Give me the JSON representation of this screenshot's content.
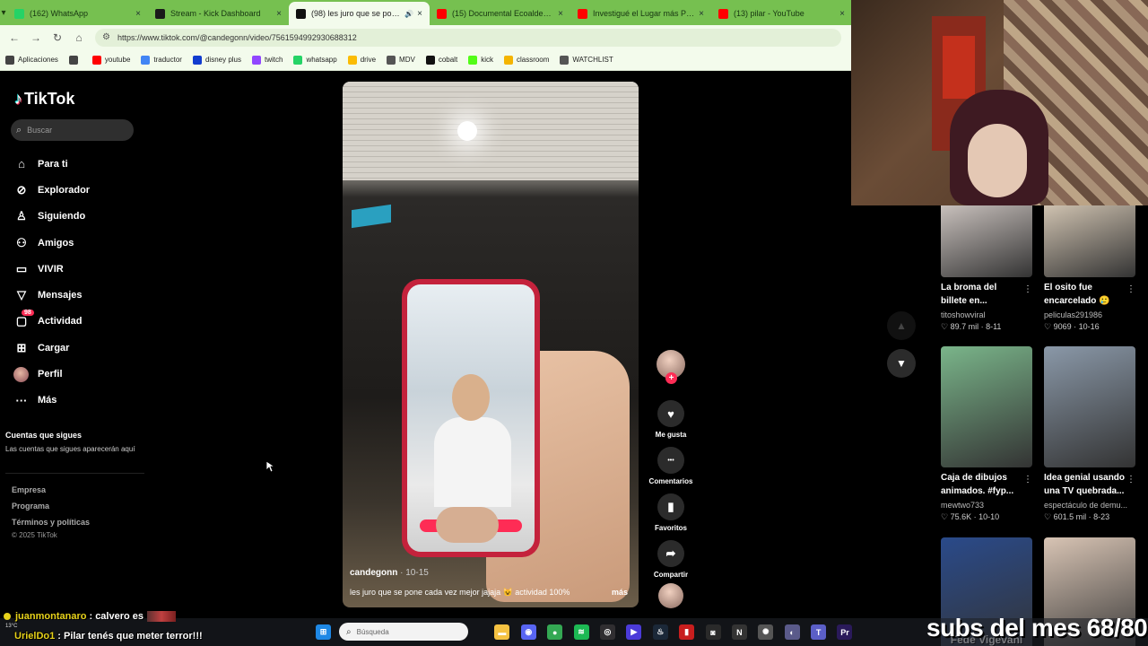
{
  "browser": {
    "tabs": [
      {
        "title": "(162) WhatsApp",
        "icon": "whatsapp-icon",
        "color": "#25d366"
      },
      {
        "title": "Stream - Kick Dashboard",
        "icon": "kick-icon",
        "color": "#1a1a1a"
      },
      {
        "title": "(98) les juro que se pone c...",
        "icon": "tiktok-icon",
        "color": "#111111",
        "active": true
      },
      {
        "title": "(15) Documental Ecoaldea Velo...",
        "icon": "youtube-icon",
        "color": "#ff0000"
      },
      {
        "title": "Investigué el Lugar más Paran...",
        "icon": "youtube-icon",
        "color": "#ff0000"
      },
      {
        "title": "(13) pilar - YouTube",
        "icon": "youtube-icon",
        "color": "#ff0000"
      }
    ],
    "url": "https://www.tiktok.com/@candegonn/video/7561594992930688312",
    "bookmarks": [
      {
        "label": "Aplicaciones",
        "icon": "apps-grid-icon",
        "color": "#444444"
      },
      {
        "label": "",
        "icon": "grid-icon",
        "color": "#444444"
      },
      {
        "label": "youtube",
        "icon": "youtube-icon",
        "color": "#ff0000"
      },
      {
        "label": "traductor",
        "icon": "translate-icon",
        "color": "#4285f4"
      },
      {
        "label": "disney plus",
        "icon": "disney-icon",
        "color": "#113ccf"
      },
      {
        "label": "twitch",
        "icon": "twitch-icon",
        "color": "#9146ff"
      },
      {
        "label": "whatsapp",
        "icon": "whatsapp-icon",
        "color": "#25d366"
      },
      {
        "label": "drive",
        "icon": "drive-icon",
        "color": "#fbbc04"
      },
      {
        "label": "MDV",
        "icon": "folder-icon",
        "color": "#555555"
      },
      {
        "label": "cobalt",
        "icon": "cobalt-icon",
        "color": "#111111"
      },
      {
        "label": "kick",
        "icon": "kick-icon",
        "color": "#53fc18"
      },
      {
        "label": "classroom",
        "icon": "classroom-icon",
        "color": "#f4b400"
      },
      {
        "label": "WATCHLIST",
        "icon": "folder-icon",
        "color": "#555555"
      }
    ]
  },
  "tiktok": {
    "brand": "TikTok",
    "search_placeholder": "Buscar",
    "nav": [
      {
        "label": "Para ti",
        "icon": "home-icon",
        "glyph": "⌂"
      },
      {
        "label": "Explorador",
        "icon": "compass-icon",
        "glyph": "⊘"
      },
      {
        "label": "Siguiendo",
        "icon": "following-icon",
        "glyph": "♙"
      },
      {
        "label": "Amigos",
        "icon": "friends-icon",
        "glyph": "⚇"
      },
      {
        "label": "VIVIR",
        "icon": "live-icon",
        "glyph": "▭"
      },
      {
        "label": "Mensajes",
        "icon": "messages-icon",
        "glyph": "▽"
      },
      {
        "label": "Actividad",
        "icon": "activity-icon",
        "glyph": "▢",
        "badge": "98"
      },
      {
        "label": "Cargar",
        "icon": "upload-icon",
        "glyph": "⊞"
      },
      {
        "label": "Perfil",
        "icon": "profile-avatar",
        "glyph": ""
      },
      {
        "label": "Más",
        "icon": "more-icon",
        "glyph": "···"
      }
    ],
    "following_heading": "Cuentas que sigues",
    "following_subtext": "Las cuentas que sigues aparecerán aquí",
    "footer_links": [
      "Empresa",
      "Programa",
      "Términos y políticas"
    ],
    "copyright": "© 2025 TikTok"
  },
  "video": {
    "author": "candegonn",
    "date": "10-15",
    "caption": "les juro que se pone cada vez mejor jajaja 😺 actividad 100%",
    "more_label": "más",
    "actions": [
      {
        "label": "Me gusta",
        "icon": "heart-icon",
        "glyph": "♥"
      },
      {
        "label": "Comentarios",
        "icon": "comment-icon",
        "glyph": "•••"
      },
      {
        "label": "Favoritos",
        "icon": "bookmark-icon",
        "glyph": "▮"
      },
      {
        "label": "Compartir",
        "icon": "share-icon",
        "glyph": "➦"
      }
    ]
  },
  "recommended": [
    {
      "title": "La broma del billete en...",
      "author": "titoshowviral",
      "likes": "89.7 mil",
      "date": "8-11",
      "thumb_color": "#c8c0bc"
    },
    {
      "title": "El osito fue encarcelado 🥲",
      "author": "peliculas291986",
      "likes": "9069",
      "date": "10-16",
      "thumb_color": "#cfc2b0"
    },
    {
      "title": "Caja de dibujos animados. #fyp...",
      "author": "mewtwo733",
      "likes": "75.6K",
      "date": "10-10",
      "thumb_color": "#7ab58a"
    },
    {
      "title": "Idea genial usando una TV quebrada...",
      "author": "espectáculo de demu...",
      "likes": "601.5 mil",
      "date": "8-23",
      "thumb_color": "#8a98a8"
    },
    {
      "title": "Fede Vigevani",
      "author": "",
      "likes": "",
      "date": "",
      "thumb_color": "#2a4a8a"
    },
    {
      "title": "",
      "author": "",
      "likes": "",
      "date": "",
      "thumb_color": "#d8c4b4"
    }
  ],
  "chat": [
    {
      "user": "juanmontanaro",
      "message": "calvero es"
    },
    {
      "user": "UrielDo1",
      "message": "Pilar tenés que meter terror!!!"
    }
  ],
  "weather": "13°C",
  "taskbar": {
    "search_placeholder": "Búsqueda",
    "apps": [
      {
        "icon": "explorer-icon",
        "color": "#f5c242",
        "glyph": "▬"
      },
      {
        "icon": "discord-icon",
        "color": "#5865f2",
        "glyph": "◉"
      },
      {
        "icon": "chrome-icon",
        "color": "#34a853",
        "glyph": "●"
      },
      {
        "icon": "spotify-icon",
        "color": "#1db954",
        "glyph": "≋"
      },
      {
        "icon": "obs-icon",
        "color": "#302e31",
        "glyph": "◎"
      },
      {
        "icon": "kick-launcher-icon",
        "color": "#4b3bd9",
        "glyph": "▶"
      },
      {
        "icon": "steam-icon",
        "color": "#1b2838",
        "glyph": "♨"
      },
      {
        "icon": "rockstar-icon",
        "color": "#c81e1e",
        "glyph": "▮"
      },
      {
        "icon": "epic-icon",
        "color": "#2a2a2a",
        "glyph": "◙"
      },
      {
        "icon": "notion-icon",
        "color": "#333333",
        "glyph": "N"
      },
      {
        "icon": "chatgpt-icon",
        "color": "#555555",
        "glyph": "✺"
      },
      {
        "icon": "voicemod-icon",
        "color": "#5a5a8a",
        "glyph": "◐"
      },
      {
        "icon": "teams-icon",
        "color": "#5b5fc7",
        "glyph": "T"
      },
      {
        "icon": "premiere-icon",
        "color": "#2a1a5a",
        "glyph": "Pr"
      }
    ]
  },
  "stream_overlay": {
    "subs_goal": "subs del mes 68/80"
  }
}
